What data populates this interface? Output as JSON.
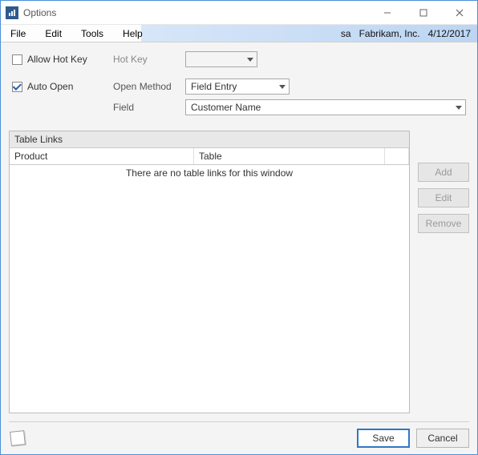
{
  "titlebar": {
    "title": "Options"
  },
  "menubar": {
    "items": [
      "File",
      "Edit",
      "Tools",
      "Help"
    ],
    "user": "sa",
    "company": "Fabrikam, Inc.",
    "date": "4/12/2017"
  },
  "form": {
    "allowHotKey": {
      "label": "Allow Hot Key",
      "checked": false
    },
    "hotKey": {
      "label": "Hot Key",
      "value": ""
    },
    "autoOpen": {
      "label": "Auto Open",
      "checked": true
    },
    "openMethod": {
      "label": "Open Method",
      "value": "Field Entry"
    },
    "field": {
      "label": "Field",
      "value": "Customer Name"
    }
  },
  "tableLinks": {
    "title": "Table Links",
    "columns": {
      "product": "Product",
      "table": "Table"
    },
    "emptyMessage": "There are no table links for this window"
  },
  "sideButtons": {
    "add": "Add",
    "edit": "Edit",
    "remove": "Remove"
  },
  "footer": {
    "save": "Save",
    "cancel": "Cancel"
  }
}
